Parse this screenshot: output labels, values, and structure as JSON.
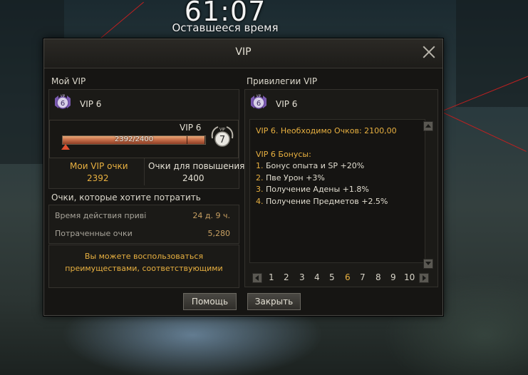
{
  "hud": {
    "timer": "61:07",
    "timer_label": "Оставшееся время"
  },
  "window": {
    "title": "VIP"
  },
  "my_vip": {
    "heading": "Мой VIP",
    "level_name": "VIP 6",
    "icon_number": "6",
    "gauge": {
      "level_label": "VIP 6",
      "text": "2392/2400",
      "current": 2392,
      "max": 2400,
      "next_level": "7"
    },
    "points_label": "Мои VIP очки",
    "points_value": "2392",
    "upgrade_label": "Очки для повышения",
    "upgrade_value": "2400",
    "spend_heading": "Очки, которые хотите потратить",
    "duration_label": "Время действия приві",
    "duration_value": "24 д. 9 ч.",
    "spent_label": "Потраченные очки",
    "spent_value": "5,280",
    "note_line1": "Вы можете воспользоваться",
    "note_line2": "преимуществами, соответствующими"
  },
  "privileges": {
    "heading": "Привилегии VIP",
    "level_name": "VIP 6",
    "icon_number": "6",
    "required": "VIP 6. Необходимо Очков: 2100,00",
    "bonus_heading": "VIP 6 Бонусы:",
    "bonuses": [
      {
        "num": "1.",
        "text": "Бонус опыта и SP +20%"
      },
      {
        "num": "2.",
        "text": "Пве Урон +3%"
      },
      {
        "num": "3.",
        "text": "Получение Адены +1.8%"
      },
      {
        "num": "4.",
        "text": "Получение Предметов +2.5%"
      }
    ],
    "pages": [
      "1",
      "2",
      "3",
      "4",
      "5",
      "6",
      "7",
      "8",
      "9",
      "10"
    ],
    "active_page": "6"
  },
  "buttons": {
    "help": "Помощь",
    "close": "Закрыть"
  },
  "colors": {
    "gold": "#e8b040",
    "value_tan": "#c8a062",
    "gauge_fill": "#c8704a"
  }
}
